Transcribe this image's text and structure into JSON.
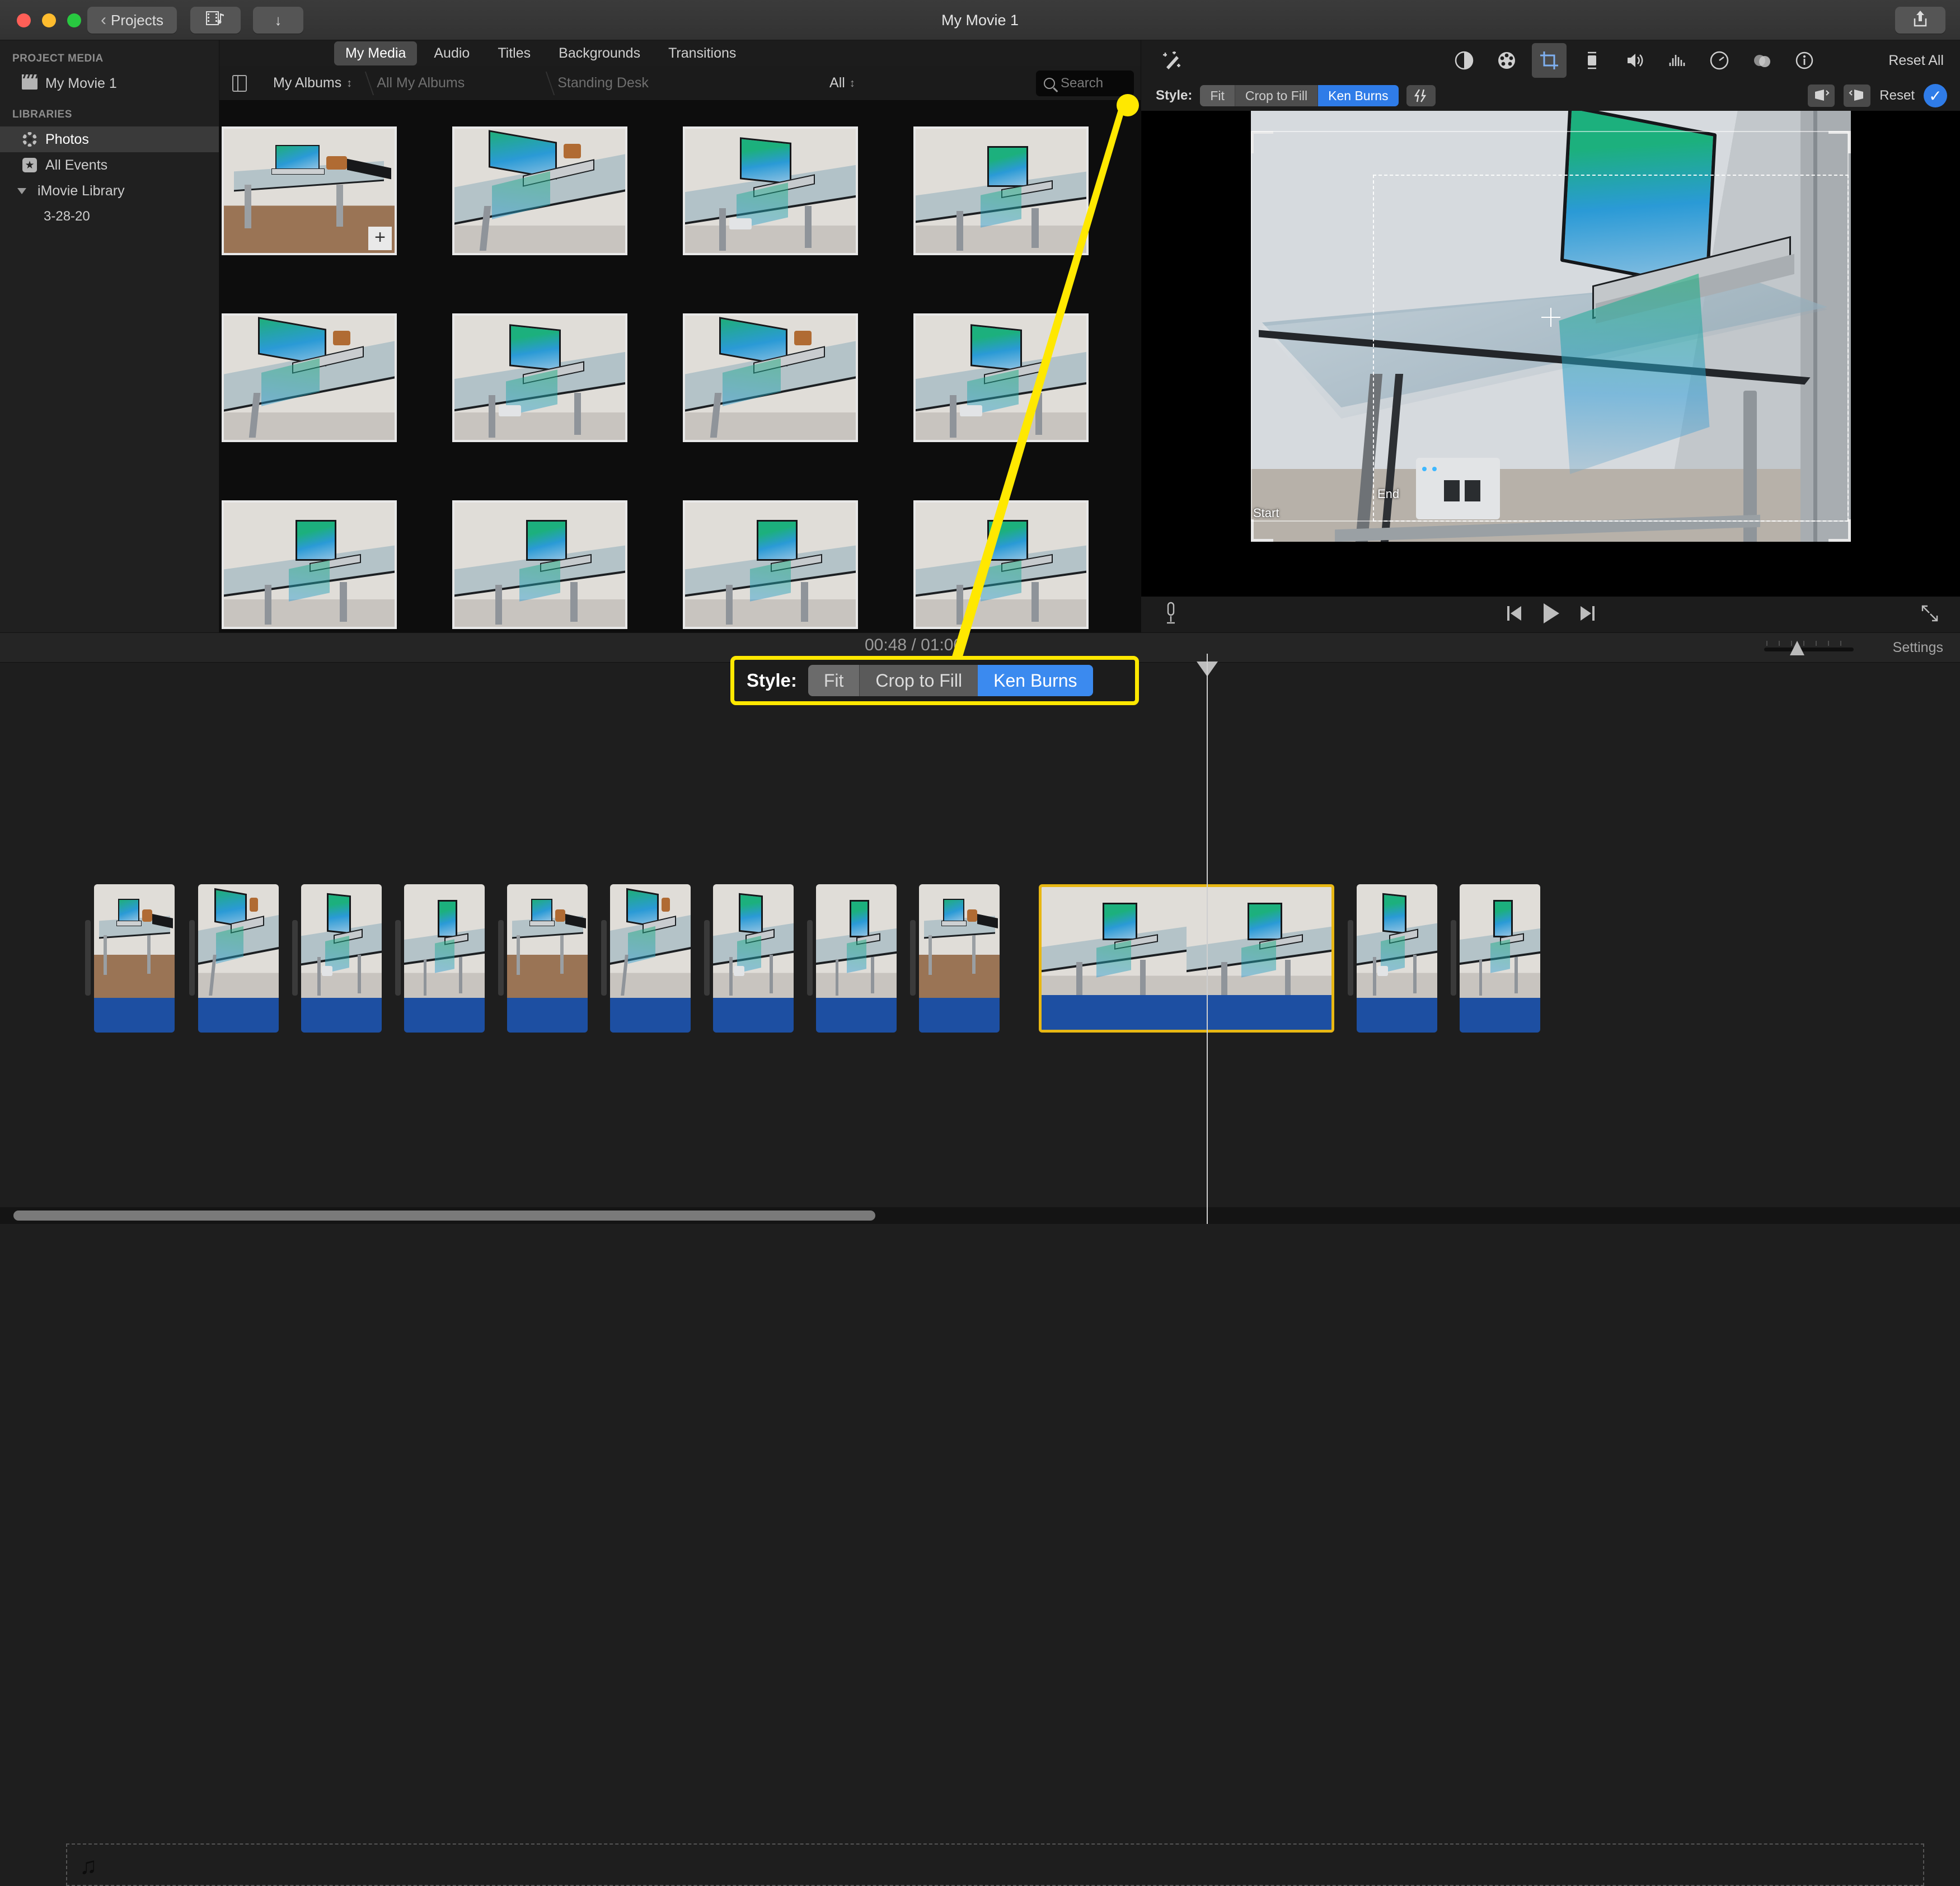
{
  "window": {
    "title": "My Movie 1",
    "projects_button": "Projects",
    "back_chevron": "‹",
    "media_icon": "media-import-icon",
    "import_icon": "↓",
    "share_icon": "share-icon"
  },
  "tabs": [
    {
      "label": "My Media",
      "active": true
    },
    {
      "label": "Audio",
      "active": false
    },
    {
      "label": "Titles",
      "active": false
    },
    {
      "label": "Backgrounds",
      "active": false
    },
    {
      "label": "Transitions",
      "active": false
    }
  ],
  "sidebar": {
    "section_project": "PROJECT MEDIA",
    "project_item": "My Movie 1",
    "section_libraries": "LIBRARIES",
    "items": [
      {
        "label": "Photos",
        "selected": true
      },
      {
        "label": "All Events",
        "selected": false
      },
      {
        "label": "iMovie Library",
        "selected": false
      },
      {
        "label": "3-28-20",
        "selected": false
      }
    ]
  },
  "browser": {
    "sidebar_toggle": "sidebar-toggle-icon",
    "breadcrumbs": [
      {
        "label": "My Albums",
        "active": true,
        "has_menu": true
      },
      {
        "label": "All My Albums",
        "active": false,
        "has_menu": false
      },
      {
        "label": "Standing Desk",
        "active": false,
        "has_menu": false
      }
    ],
    "filter": "All",
    "search_placeholder": "Search",
    "thumbnail_badge": "+"
  },
  "inspector": {
    "tools": [
      {
        "name": "auto-enhance-icon",
        "active": false
      },
      {
        "name": "color-balance-icon",
        "active": false
      },
      {
        "name": "color-correction-icon",
        "active": false
      },
      {
        "name": "cropping-icon",
        "active": true
      },
      {
        "name": "stabilization-icon",
        "active": false
      },
      {
        "name": "volume-icon",
        "active": false
      },
      {
        "name": "noise-reduction-icon",
        "active": false
      },
      {
        "name": "speed-icon",
        "active": false
      },
      {
        "name": "clip-filter-icon",
        "active": false
      },
      {
        "name": "info-icon",
        "active": false
      }
    ],
    "reset_all": "Reset All",
    "style_label": "Style:",
    "style_options": [
      {
        "label": "Fit",
        "selected": false
      },
      {
        "label": "Crop to Fill",
        "selected": false
      },
      {
        "label": "Ken Burns",
        "selected": true
      }
    ],
    "auto_button": "auto-crop-icon",
    "rotate_ccw": "rotate-counterclockwise-icon",
    "rotate_cw": "rotate-clockwise-icon",
    "reset": "Reset",
    "apply": "apply-checkmark-icon"
  },
  "viewer": {
    "start_label": "Start",
    "end_label": "End",
    "crosshair": "crosshair-icon",
    "transport": {
      "voiceover": "microphone-icon",
      "previous": "skip-to-beginning-icon",
      "play": "play-icon",
      "next": "skip-to-end-icon",
      "fullscreen": "fullscreen-icon"
    }
  },
  "timeline_toolbar": {
    "timecode": "00:48 / 01:00",
    "zoom_slider": "timeline-zoom-slider",
    "settings": "Settings"
  },
  "timeline": {
    "clip_count": 13,
    "selected_clip_index": 9,
    "selected_border_color": "#e8b713",
    "audio_bar_color": "#1d4fa2",
    "music_dropzone_icon": "♫"
  },
  "callout": {
    "style_label": "Style:",
    "options": [
      {
        "label": "Fit",
        "selected": false
      },
      {
        "label": "Crop to Fill",
        "selected": false
      },
      {
        "label": "Ken Burns",
        "selected": true
      }
    ],
    "highlight_color": "#ffe800"
  },
  "colors": {
    "accent_blue": "#2f7ce8",
    "highlight_yellow": "#ffe800",
    "selection_yellow": "#e8b713",
    "audio_blue": "#1d4fa2"
  }
}
